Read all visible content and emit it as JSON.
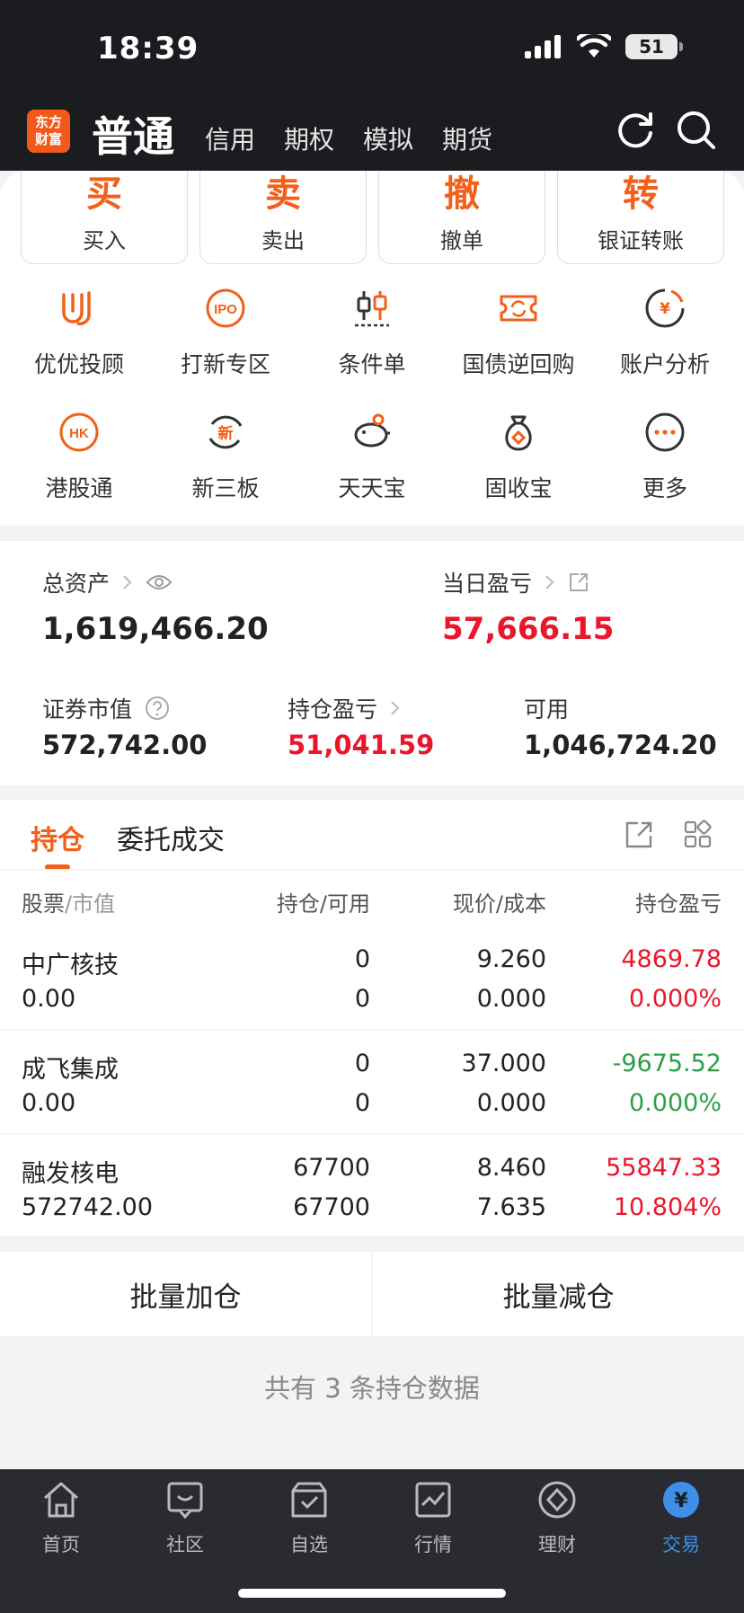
{
  "status_bar": {
    "time": "18:39",
    "battery": "51"
  },
  "header": {
    "logo_text": "东方财富",
    "active_tab": "普通",
    "tabs": [
      "信用",
      "期权",
      "模拟",
      "期货"
    ]
  },
  "quick_actions": [
    {
      "glyph": "买",
      "label": "买入"
    },
    {
      "glyph": "卖",
      "label": "卖出"
    },
    {
      "glyph": "撤",
      "label": "撤单"
    },
    {
      "glyph": "转",
      "label": "银证转账"
    }
  ],
  "grid": [
    {
      "icon": "youyou-icon",
      "label": "优优投顾"
    },
    {
      "icon": "ipo-icon",
      "label": "打新专区",
      "icon_text": "IPO"
    },
    {
      "icon": "candlestick-icon",
      "label": "条件单"
    },
    {
      "icon": "repo-icon",
      "label": "国债逆回购"
    },
    {
      "icon": "account-analysis-icon",
      "label": "账户分析",
      "icon_text": "¥"
    },
    {
      "icon": "hk-icon",
      "label": "港股通",
      "icon_text": "HK"
    },
    {
      "icon": "new-third-board-icon",
      "label": "新三板",
      "icon_text": "新"
    },
    {
      "icon": "piggy-bank-icon",
      "label": "天天宝"
    },
    {
      "icon": "money-bag-icon",
      "label": "固收宝"
    },
    {
      "icon": "more-icon",
      "label": "更多"
    }
  ],
  "assets": {
    "total_label": "总资产",
    "total_value": "1,619,466.20",
    "daily_pnl_label": "当日盈亏",
    "daily_pnl_value": "57,666.15",
    "market_value_label": "证券市值",
    "market_value": "572,742.00",
    "position_pnl_label": "持仓盈亏",
    "position_pnl": "51,041.59",
    "available_label": "可用",
    "available": "1,046,724.20"
  },
  "positions": {
    "tab_hold": "持仓",
    "tab_orders": "委托成交",
    "headers": {
      "stock": "股票",
      "market_value": "/市值",
      "hold": "持仓",
      "available": "/可用",
      "price": "现价",
      "cost": "/成本",
      "pnl": "持仓盈亏"
    },
    "rows": [
      {
        "name": "中广核技",
        "market_value": "0.00",
        "hold": "0",
        "available": "0",
        "price": "9.260",
        "cost": "0.000",
        "pnl": "4869.78",
        "pnl_pct": "0.000%",
        "pnl_color": "#e8172b",
        "pct_color": "#e8172b"
      },
      {
        "name": "成飞集成",
        "market_value": "0.00",
        "hold": "0",
        "available": "0",
        "price": "37.000",
        "cost": "0.000",
        "pnl": "-9675.52",
        "pnl_pct": "0.000%",
        "pnl_color": "#2aa146",
        "pct_color": "#2aa146"
      },
      {
        "name": "融发核电",
        "market_value": "572742.00",
        "hold": "67700",
        "available": "67700",
        "price": "8.460",
        "cost": "7.635",
        "pnl": "55847.33",
        "pnl_pct": "10.804%",
        "pnl_color": "#e8172b",
        "pct_color": "#e8172b"
      }
    ]
  },
  "batch": {
    "add": "批量加仓",
    "reduce": "批量减仓"
  },
  "count_text": "共有 3 条持仓数据",
  "tabbar": [
    {
      "icon": "home-icon",
      "label": "首页"
    },
    {
      "icon": "community-icon",
      "label": "社区"
    },
    {
      "icon": "watchlist-icon",
      "label": "自选"
    },
    {
      "icon": "market-icon",
      "label": "行情"
    },
    {
      "icon": "wealth-icon",
      "label": "理财"
    },
    {
      "icon": "trade-icon",
      "label": "交易",
      "icon_text": "¥"
    }
  ],
  "colors": {
    "accent": "#f2601a",
    "up": "#e8172b",
    "down": "#2aa146",
    "tab_active": "#3d8fe8"
  }
}
